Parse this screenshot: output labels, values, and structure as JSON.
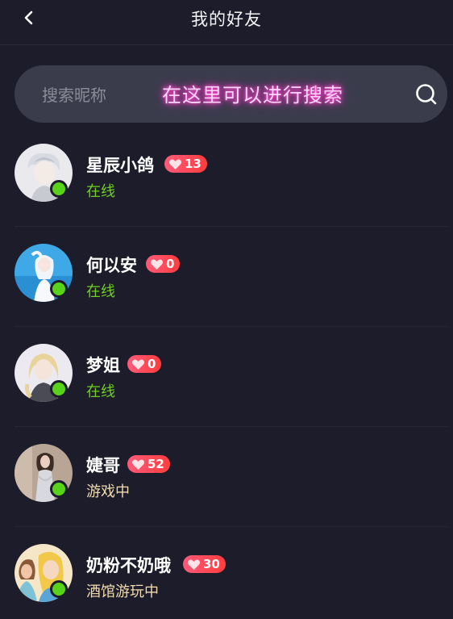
{
  "header": {
    "title": "我的好友",
    "back_icon": "chevron-left-icon"
  },
  "search": {
    "placeholder": "搜索昵称",
    "hint": "在这里可以进行搜索",
    "icon": "search-icon"
  },
  "colors": {
    "background": "#1c1c2a",
    "search_bg": "#3a3c4c",
    "online": "#58d21a",
    "status_online": "#6fcf24",
    "status_activity": "#f2dcae",
    "badge": "#ff4a5c",
    "hint_glow": "#ff36c8"
  },
  "friends": [
    {
      "name": "星辰小鸽",
      "intimacy": "13",
      "status": "在线",
      "status_type": "online"
    },
    {
      "name": "何以安",
      "intimacy": "0",
      "status": "在线",
      "status_type": "online"
    },
    {
      "name": "梦姐",
      "intimacy": "0",
      "status": "在线",
      "status_type": "online"
    },
    {
      "name": "婕哥",
      "intimacy": "52",
      "status": "游戏中",
      "status_type": "activity"
    },
    {
      "name": "奶粉不奶哦",
      "intimacy": "30",
      "status": "酒馆游玩中",
      "status_type": "activity"
    }
  ]
}
